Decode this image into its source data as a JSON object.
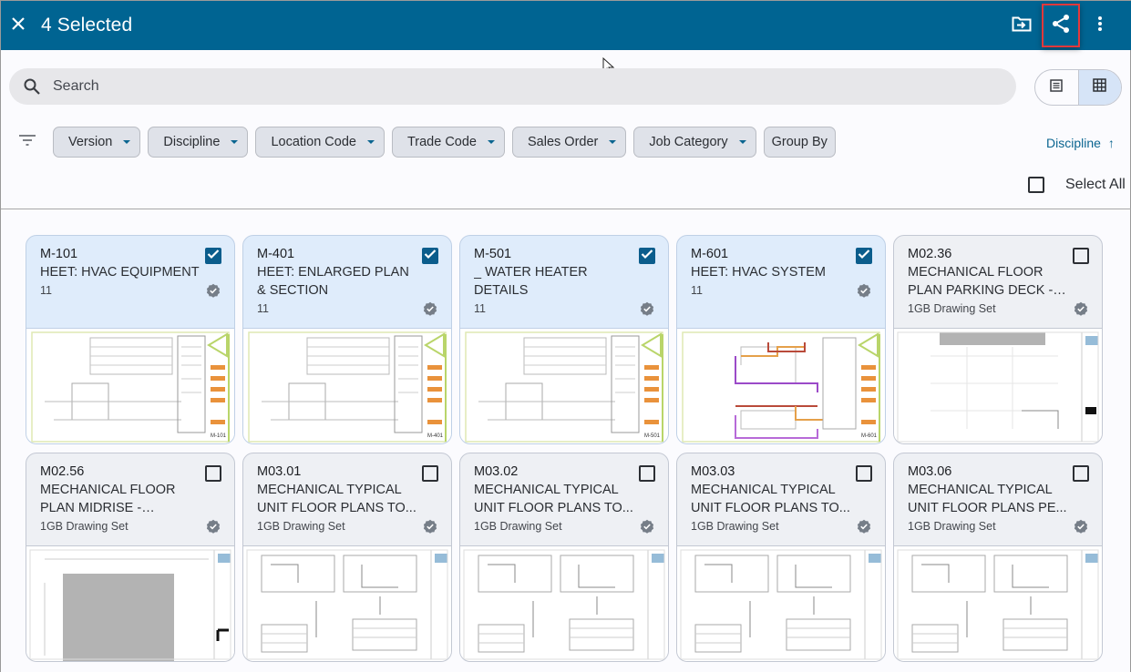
{
  "appbar": {
    "title": "4 Selected",
    "close_icon": "close-icon",
    "actions": [
      {
        "name": "move-to-folder",
        "icon": "folder-move-icon"
      },
      {
        "name": "share",
        "icon": "share-icon",
        "highlighted": true
      },
      {
        "name": "more",
        "icon": "more-vert-icon"
      }
    ],
    "highlight_color": "#e5383b",
    "color": "#006492"
  },
  "search": {
    "placeholder": "Search",
    "value": ""
  },
  "view_toggle": {
    "options": [
      {
        "name": "list-view",
        "icon": "list-icon",
        "active": false
      },
      {
        "name": "grid-view",
        "icon": "grid-icon",
        "active": true
      }
    ]
  },
  "filters": {
    "icon": "filter-icon",
    "chips": [
      {
        "label": "Version",
        "dropdown": true
      },
      {
        "label": "Discipline",
        "dropdown": true
      },
      {
        "label": "Location Code",
        "dropdown": true
      },
      {
        "label": "Trade Code",
        "dropdown": true
      },
      {
        "label": "Sales Order",
        "dropdown": true
      },
      {
        "label": "Job Category",
        "dropdown": true
      },
      {
        "label": "Group By",
        "dropdown": false
      }
    ]
  },
  "sort": {
    "label": "Discipline",
    "direction": "ascending",
    "arrow": "↑"
  },
  "select_all": {
    "label": "Select All",
    "checked": false
  },
  "cards": [
    {
      "code": "M-101",
      "name": "HEET: HVAC EQUIPMENT",
      "sub": "11",
      "selected": true,
      "verified": true,
      "sheet": "M-101"
    },
    {
      "code": "M-401",
      "name": "HEET: ENLARGED PLAN & SECTION",
      "sub": "11",
      "selected": true,
      "verified": true,
      "sheet": "M-401"
    },
    {
      "code": "M-501",
      "name": "_ WATER HEATER DETAILS",
      "sub": "11",
      "selected": true,
      "verified": true,
      "sheet": "M-501"
    },
    {
      "code": "M-601",
      "name": "HEET: HVAC SYSTEM",
      "sub": "11",
      "selected": true,
      "verified": true,
      "sheet": "M-601"
    },
    {
      "code": "M02.36",
      "name": "MECHANICAL FLOOR PLAN PARKING DECK - ...",
      "sub": "1GB Drawing Set",
      "selected": false,
      "verified": true,
      "sheet": ""
    },
    {
      "code": "M02.56",
      "name": "MECHANICAL FLOOR PLAN MIDRISE - ROOFP...",
      "sub": "1GB Drawing Set",
      "selected": false,
      "verified": true,
      "sheet": ""
    },
    {
      "code": "M03.01",
      "name": "MECHANICAL TYPICAL UNIT FLOOR PLANS TO...",
      "sub": "1GB Drawing Set",
      "selected": false,
      "verified": true,
      "sheet": ""
    },
    {
      "code": "M03.02",
      "name": "MECHANICAL TYPICAL UNIT FLOOR PLANS TO...",
      "sub": "1GB Drawing Set",
      "selected": false,
      "verified": true,
      "sheet": ""
    },
    {
      "code": "M03.03",
      "name": "MECHANICAL TYPICAL UNIT FLOOR PLANS TO...",
      "sub": "1GB Drawing Set",
      "selected": false,
      "verified": true,
      "sheet": ""
    },
    {
      "code": "M03.06",
      "name": "MECHANICAL TYPICAL UNIT FLOOR PLANS PE...",
      "sub": "1GB Drawing Set",
      "selected": false,
      "verified": true,
      "sheet": ""
    }
  ]
}
